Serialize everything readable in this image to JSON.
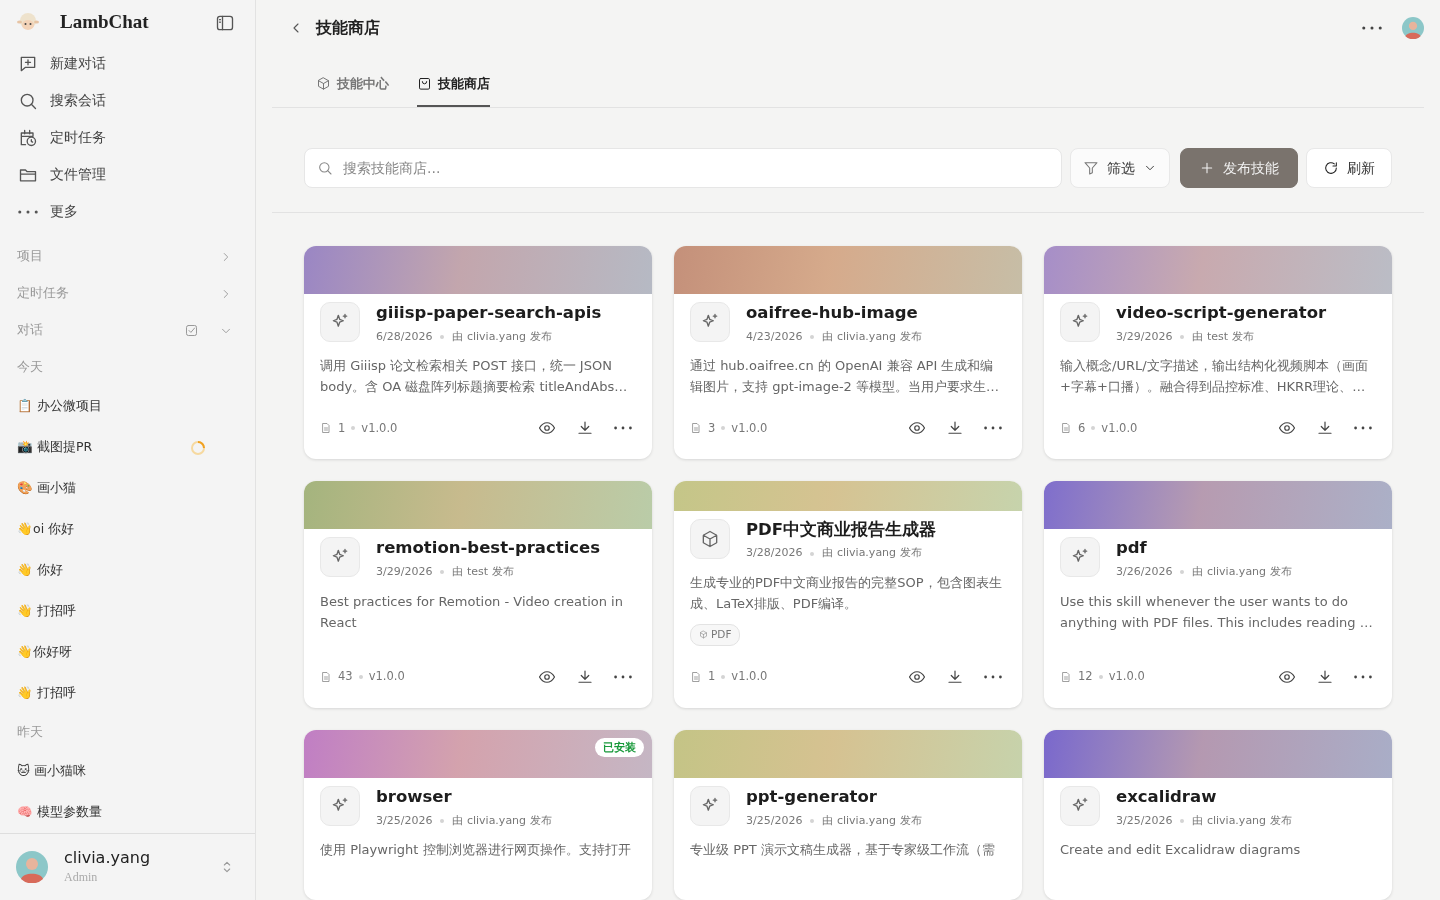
{
  "sidebar": {
    "brand": "LambChat",
    "menu": [
      "新建对话",
      "搜索会话",
      "定时任务",
      "文件管理",
      "更多"
    ],
    "sections": [
      {
        "label": "项目",
        "expanded": false
      },
      {
        "label": "定时任务",
        "expanded": false
      },
      {
        "label": "对话",
        "expanded": true
      }
    ],
    "history": [
      {
        "group": "今天",
        "items": [
          {
            "title": "📋 办公微项目",
            "loading": false
          },
          {
            "title": "📸 截图提PR",
            "loading": true
          },
          {
            "title": "🎨 画小猫",
            "loading": false
          },
          {
            "title": "👋oi 你好",
            "loading": false
          },
          {
            "title": "👋 你好",
            "loading": false
          },
          {
            "title": "👋 打招呼",
            "loading": false
          },
          {
            "title": "👋你好呀",
            "loading": false
          },
          {
            "title": "👋 打招呼",
            "loading": false
          }
        ]
      },
      {
        "group": "昨天",
        "items": [
          {
            "title": "🐱 画小猫咪",
            "loading": false
          },
          {
            "title": "🧠 模型参数量",
            "loading": false
          }
        ]
      }
    ],
    "user": {
      "name": "clivia.yang",
      "role": "Admin"
    }
  },
  "header": {
    "title": "技能商店"
  },
  "tabs": [
    {
      "label": "技能中心",
      "selected": false
    },
    {
      "label": "技能商店",
      "selected": true
    }
  ],
  "toolbar": {
    "search": {
      "placeholder": "搜索技能商店..."
    },
    "filter": "筛选",
    "publish": "发布技能",
    "refresh": "刷新"
  },
  "skills": [
    {
      "name": "giiisp-paper-search-apis",
      "kind": "sparkle",
      "color": "#9a86c4",
      "date": "6/28/2026",
      "author": "由 clivia.yang 发布",
      "description": "调用 Giiisp 论文检索相关 POST 接口，统一 JSON body。含 OA 磁盘阵列标题摘要检索 titleAndAbs…",
      "files": "1",
      "version": "v1.0.0"
    },
    {
      "name": "oaifree-hub-image",
      "kind": "sparkle",
      "color": "#c4907a",
      "date": "4/23/2026",
      "author": "由 clivia.yang 发布",
      "description": "通过 hub.oaifree.cn 的 OpenAI 兼容 API 生成和编辑图片，支持 gpt-image-2 等模型。当用户要求生…",
      "files": "3",
      "version": "v1.0.0"
    },
    {
      "name": "video-script-generator",
      "kind": "sparkle",
      "color": "#a68ec8",
      "date": "3/29/2026",
      "author": "由 test 发布",
      "description": "输入概念/URL/文字描述，输出结构化视频脚本（画面+字幕+口播）。融合得到品控标准、HKRR理论、…",
      "files": "6",
      "version": "v1.0.0"
    },
    {
      "name": "remotion-best-practices",
      "kind": "sparkle",
      "color": "#a4b47e",
      "date": "3/29/2026",
      "author": "由 test 发布",
      "description": "Best practices for Remotion - Video creation in React",
      "files": "43",
      "version": "v1.0.0"
    },
    {
      "name": "PDF中文商业报告生成器",
      "kind": "package",
      "color": "#c4c688",
      "date": "3/28/2026",
      "author": "由 clivia.yang 发布",
      "description": "生成专业的PDF中文商业报告的完整SOP，包含图表生成、LaTeX排版、PDF编译。",
      "tags": [
        "PDF"
      ],
      "files": "1",
      "version": "v1.0.0"
    },
    {
      "name": "pdf",
      "kind": "sparkle",
      "color": "#7f6ecc",
      "date": "3/26/2026",
      "author": "由 clivia.yang 发布",
      "description": "Use this skill whenever the user wants to do anything with PDF files. This includes reading …",
      "files": "12",
      "version": "v1.0.0"
    },
    {
      "name": "browser",
      "kind": "sparkle",
      "color": "#c07ec4",
      "badge": "已安装",
      "date": "3/25/2026",
      "author": "由 clivia.yang 发布",
      "description": "使用 Playwright 控制浏览器进行网页操作。支持打开"
    },
    {
      "name": "ppt-generator",
      "kind": "sparkle",
      "color": "#c4c486",
      "date": "3/25/2026",
      "author": "由 clivia.yang 发布",
      "description": "专业级 PPT 演示文稿生成器，基于专家级工作流（需"
    },
    {
      "name": "excalidraw",
      "kind": "sparkle",
      "color": "#7a68cc",
      "date": "3/25/2026",
      "author": "由 clivia.yang 发布",
      "description": "Create and edit Excalidraw diagrams"
    }
  ]
}
